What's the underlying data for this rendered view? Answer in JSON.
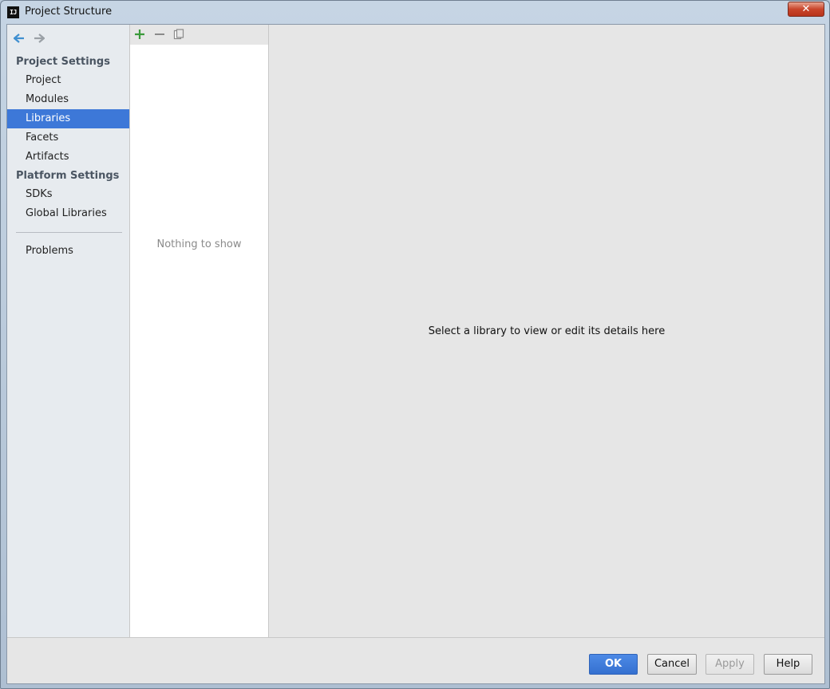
{
  "window": {
    "title": "Project Structure",
    "app_icon_text": "IJ",
    "close_glyph": "✕"
  },
  "nav": {
    "back_icon": "arrow-left-icon",
    "forward_icon": "arrow-right-icon",
    "groups": [
      {
        "label": "Project Settings"
      },
      {
        "label": "Platform Settings"
      }
    ],
    "items": [
      {
        "label": "Project"
      },
      {
        "label": "Modules"
      },
      {
        "label": "Libraries"
      },
      {
        "label": "Facets"
      },
      {
        "label": "Artifacts"
      },
      {
        "label": "SDKs"
      },
      {
        "label": "Global Libraries"
      },
      {
        "label": "Problems"
      }
    ],
    "selected": "Libraries"
  },
  "list": {
    "toolbar_icons": [
      "add-icon",
      "remove-icon",
      "copy-icon"
    ],
    "empty_text": "Nothing to show"
  },
  "detail": {
    "placeholder": "Select a library to view or edit its details here"
  },
  "buttons": {
    "ok": "OK",
    "cancel": "Cancel",
    "apply": "Apply",
    "help": "Help"
  },
  "colors": {
    "selection": "#3d78d8",
    "add_icon": "#3a9a3a",
    "nav_arrow_active": "#3f8fd0",
    "close_button": "#c9452b"
  }
}
